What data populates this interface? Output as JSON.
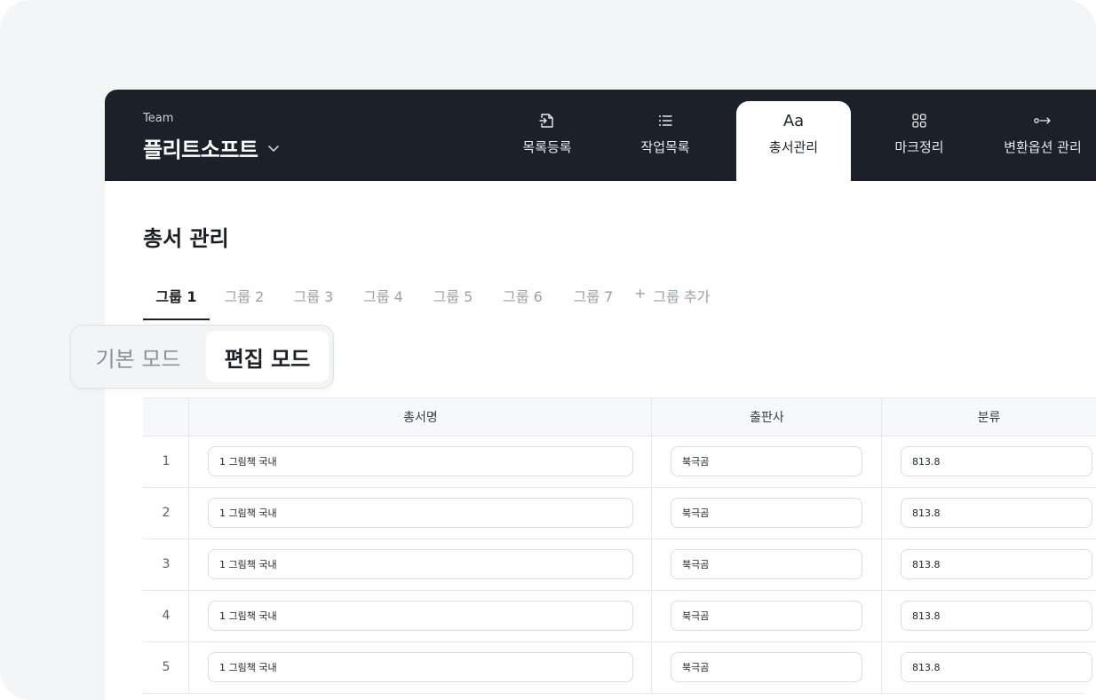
{
  "header": {
    "team_caption": "Team",
    "team_name": "플리트소프트",
    "nav": [
      {
        "label": "목록등록",
        "icon": "file-import-icon"
      },
      {
        "label": "작업목록",
        "icon": "list-icon"
      },
      {
        "label": "총서관리",
        "icon": "font-icon",
        "glyph": "Aa",
        "active": true
      },
      {
        "label": "마크정리",
        "icon": "grid-icon"
      },
      {
        "label": "변환옵션 관리",
        "icon": "convert-arrow-icon"
      }
    ]
  },
  "page": {
    "title": "총서 관리"
  },
  "groups": {
    "tabs": [
      "그룹 1",
      "그룹 2",
      "그룹 3",
      "그룹 4",
      "그룹 5",
      "그룹 6",
      "그룹 7"
    ],
    "active_index": 0,
    "add_icon": "+",
    "add_label": "그룹 추가"
  },
  "mode_toggle": {
    "basic_label": "기본 모드",
    "edit_label": "편집 모드",
    "active": "edit"
  },
  "table": {
    "columns": [
      "총서명",
      "출판사",
      "분류"
    ],
    "rows": [
      {
        "num": "1",
        "series": "1 그림책 국내",
        "publisher": "북극곰",
        "class": "813.8"
      },
      {
        "num": "2",
        "series": "1 그림책 국내",
        "publisher": "북극곰",
        "class": "813.8"
      },
      {
        "num": "3",
        "series": "1 그림책 국내",
        "publisher": "북극곰",
        "class": "813.8"
      },
      {
        "num": "4",
        "series": "1 그림책 국내",
        "publisher": "북극곰",
        "class": "813.8"
      },
      {
        "num": "5",
        "series": "1 그림책 국내",
        "publisher": "북극곰",
        "class": "813.8"
      }
    ]
  },
  "colors": {
    "topbar_bg": "#1b2029",
    "frame_bg": "#f4f5f7",
    "active_text": "#1b1f24",
    "muted_text": "#9aa1ab"
  }
}
